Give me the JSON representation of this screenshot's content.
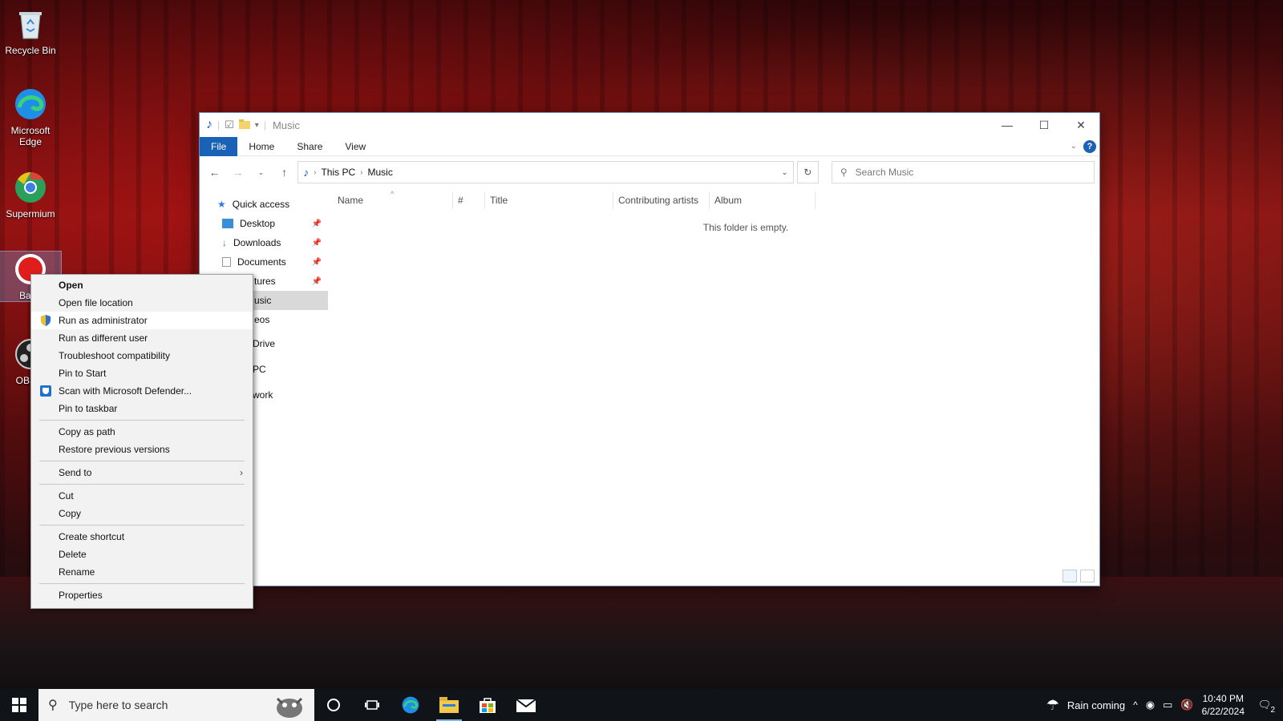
{
  "desktop": {
    "icons": [
      {
        "label": "Recycle Bin"
      },
      {
        "label": "Microsoft Edge"
      },
      {
        "label": "Supermium"
      },
      {
        "label": "Band"
      },
      {
        "label": "OBS S"
      }
    ]
  },
  "explorer": {
    "title": "Music",
    "ribbon_tabs": [
      "File",
      "Home",
      "Share",
      "View"
    ],
    "help": "?",
    "address": {
      "crumbs": [
        "This PC",
        "Music"
      ]
    },
    "search_placeholder": "Search Music",
    "nav": [
      {
        "label": "Quick access"
      },
      {
        "label": "Desktop",
        "pinned": true
      },
      {
        "label": "Downloads",
        "pinned": true
      },
      {
        "label": "Documents",
        "pinned": true
      },
      {
        "label": "tures",
        "pinned": true
      },
      {
        "label": "usic"
      },
      {
        "label": "eos"
      },
      {
        "label": "Drive"
      },
      {
        "label": "PC"
      },
      {
        "label": "work"
      }
    ],
    "columns": [
      "Name",
      "#",
      "Title",
      "Contributing artists",
      "Album"
    ],
    "empty_message": "This folder is empty."
  },
  "context_menu": {
    "items": [
      "Open",
      "Open file location",
      "Run as administrator",
      "Run as different user",
      "Troubleshoot compatibility",
      "Pin to Start",
      "Scan with Microsoft Defender...",
      "Pin to taskbar",
      "Copy as path",
      "Restore previous versions",
      "Send to",
      "Cut",
      "Copy",
      "Create shortcut",
      "Delete",
      "Rename",
      "Properties"
    ]
  },
  "taskbar": {
    "search_placeholder": "Type here to search",
    "weather": "Rain coming",
    "time": "10:40 PM",
    "date": "6/22/2024",
    "notification_count": "2"
  },
  "colors": {
    "accent": "#1a62b8",
    "taskbar": "#101418"
  }
}
